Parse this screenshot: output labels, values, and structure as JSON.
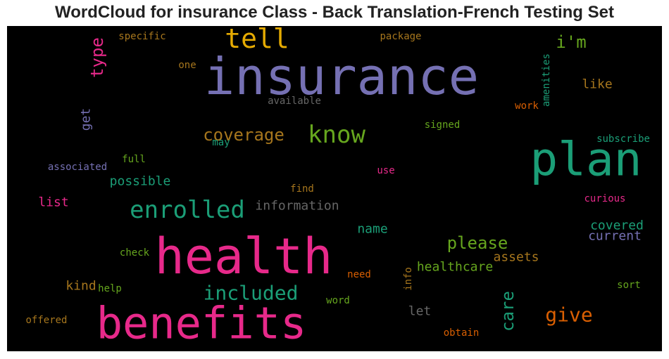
{
  "chart_data": {
    "type": "wordcloud",
    "title": "WordCloud for insurance Class - Back Translation-French Testing Set",
    "background": "#000000",
    "words": [
      {
        "text": "insurance",
        "color": "#7570b3",
        "rotate": 0
      },
      {
        "text": "health",
        "color": "#e7298a",
        "rotate": 0
      },
      {
        "text": "benefits",
        "color": "#e7298a",
        "rotate": 0
      },
      {
        "text": "plan",
        "color": "#1b9e77",
        "rotate": 0
      },
      {
        "text": "tell",
        "color": "#e6ab02",
        "rotate": 0
      },
      {
        "text": "enrolled",
        "color": "#1b9e77",
        "rotate": 0
      },
      {
        "text": "know",
        "color": "#66a61e",
        "rotate": 0
      },
      {
        "text": "included",
        "color": "#1b9e77",
        "rotate": 0
      },
      {
        "text": "coverage",
        "color": "#a6761d",
        "rotate": 0
      },
      {
        "text": "give",
        "color": "#d95f02",
        "rotate": 0
      },
      {
        "text": "type",
        "color": "#e7298a",
        "rotate": -90
      },
      {
        "text": "i'm",
        "color": "#66a61e",
        "rotate": 0
      },
      {
        "text": "please",
        "color": "#66a61e",
        "rotate": 0
      },
      {
        "text": "care",
        "color": "#1b9e77",
        "rotate": -90
      },
      {
        "text": "information",
        "color": "#666666",
        "rotate": 0
      },
      {
        "text": "possible",
        "color": "#1b9e77",
        "rotate": 0
      },
      {
        "text": "like",
        "color": "#a6761d",
        "rotate": 0
      },
      {
        "text": "get",
        "color": "#7570b3",
        "rotate": -90
      },
      {
        "text": "list",
        "color": "#e7298a",
        "rotate": 0
      },
      {
        "text": "name",
        "color": "#1b9e77",
        "rotate": 0
      },
      {
        "text": "covered",
        "color": "#1b9e77",
        "rotate": 0
      },
      {
        "text": "current",
        "color": "#7570b3",
        "rotate": 0
      },
      {
        "text": "healthcare",
        "color": "#66a61e",
        "rotate": 0
      },
      {
        "text": "assets",
        "color": "#a6761d",
        "rotate": 0
      },
      {
        "text": "kind",
        "color": "#a6761d",
        "rotate": 0
      },
      {
        "text": "let",
        "color": "#666666",
        "rotate": 0
      },
      {
        "text": "specific",
        "color": "#a6761d",
        "rotate": 0
      },
      {
        "text": "package",
        "color": "#a6761d",
        "rotate": 0
      },
      {
        "text": "one",
        "color": "#a6761d",
        "rotate": 0
      },
      {
        "text": "available",
        "color": "#666666",
        "rotate": 0
      },
      {
        "text": "amenities",
        "color": "#1b9e77",
        "rotate": -90
      },
      {
        "text": "work",
        "color": "#d95f02",
        "rotate": 0
      },
      {
        "text": "signed",
        "color": "#66a61e",
        "rotate": 0
      },
      {
        "text": "subscribe",
        "color": "#1b9e77",
        "rotate": 0
      },
      {
        "text": "may",
        "color": "#1b9e77",
        "rotate": 0
      },
      {
        "text": "full",
        "color": "#66a61e",
        "rotate": 0
      },
      {
        "text": "associated",
        "color": "#7570b3",
        "rotate": 0
      },
      {
        "text": "use",
        "color": "#e7298a",
        "rotate": 0
      },
      {
        "text": "find",
        "color": "#a6761d",
        "rotate": 0
      },
      {
        "text": "curious",
        "color": "#e7298a",
        "rotate": 0
      },
      {
        "text": "check",
        "color": "#66a61e",
        "rotate": 0
      },
      {
        "text": "need",
        "color": "#d95f02",
        "rotate": 0
      },
      {
        "text": "help",
        "color": "#66a61e",
        "rotate": 0
      },
      {
        "text": "info",
        "color": "#a6761d",
        "rotate": -90
      },
      {
        "text": "sort",
        "color": "#66a61e",
        "rotate": 0
      },
      {
        "text": "word",
        "color": "#66a61e",
        "rotate": 0
      },
      {
        "text": "offered",
        "color": "#a6761d",
        "rotate": 0
      },
      {
        "text": "obtain",
        "color": "#d95f02",
        "rotate": 0
      }
    ]
  }
}
